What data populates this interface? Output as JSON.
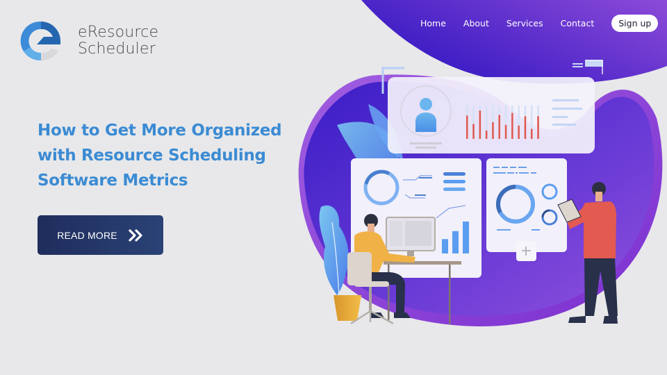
{
  "brand": {
    "name_line1": "eResource",
    "name_line2": "Scheduler",
    "logo_icon": "e-logo-icon"
  },
  "nav": {
    "items": [
      {
        "label": "Home"
      },
      {
        "label": "About"
      },
      {
        "label": "Services"
      },
      {
        "label": "Contact"
      }
    ],
    "signup_label": "Sign up"
  },
  "hero": {
    "headline_lines": [
      "How to Get More Organized",
      "with Resource Scheduling",
      "Software Metrics"
    ],
    "cta_label": "READ MORE",
    "cta_icon": "double-chevron-right-icon"
  },
  "illustration": {
    "profile_card_bars": [
      0.7,
      0.45,
      0.85,
      0.25,
      0.5,
      0.72,
      0.42,
      0.78,
      0.4,
      0.68,
      0.3,
      0.68
    ],
    "bar_chart_values": [
      0.45,
      0.7,
      1.0
    ]
  },
  "colors": {
    "background": "#e8e8ea",
    "headline": "#3b8bd3",
    "cta_start": "#1f2d5c",
    "cta_end": "#2a4276",
    "header_gradient_start": "#3b1fc4",
    "header_gradient_end": "#8a48d8",
    "accent_red": "#e0584f",
    "accent_blue": "#5a9df0"
  }
}
